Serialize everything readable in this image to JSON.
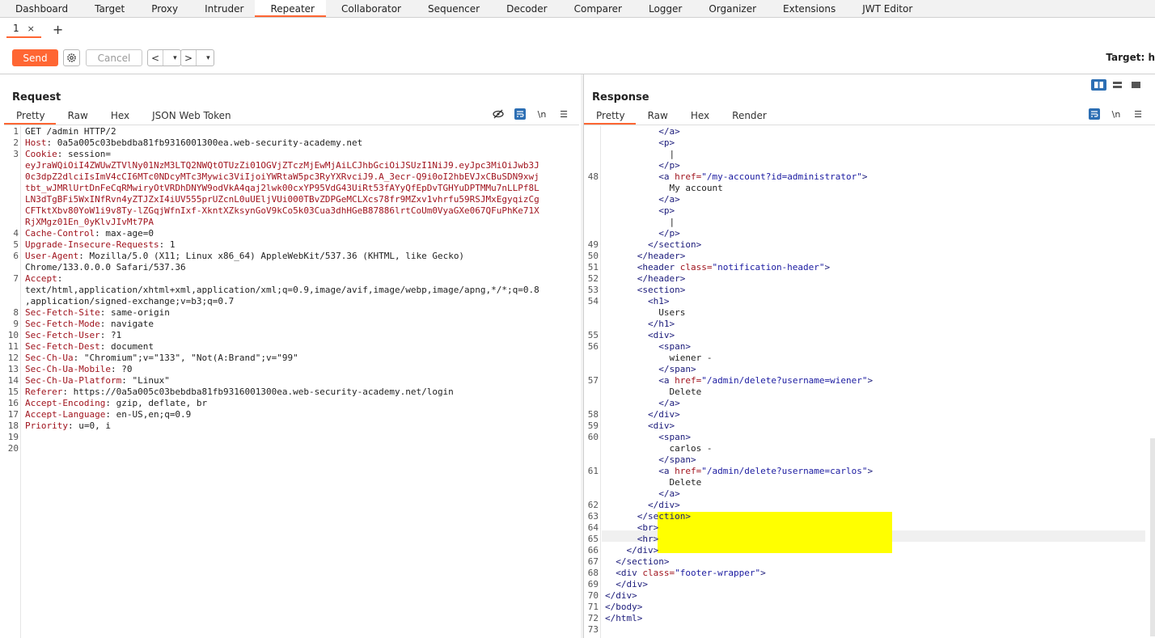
{
  "topnav": [
    "Dashboard",
    "Target",
    "Proxy",
    "Intruder",
    "Repeater",
    "Collaborator",
    "Sequencer",
    "Decoder",
    "Comparer",
    "Logger",
    "Organizer",
    "Extensions",
    "JWT Editor"
  ],
  "active_tab": "Repeater",
  "subtab": {
    "label": "1",
    "close": "×",
    "add": "+"
  },
  "toolbar": {
    "send": "Send",
    "cancel": "Cancel",
    "back": "<",
    "forward": ">",
    "dropdown": "▾",
    "target": "Target: h"
  },
  "request": {
    "title": "Request",
    "tabs": [
      "Pretty",
      "Raw",
      "Hex",
      "JSON Web Token"
    ],
    "icons": {
      "hide": "eye-slash-icon",
      "wrap": "wrap-icon",
      "newline": "\\n",
      "menu": "☰"
    },
    "lines": [
      {
        "n": "1",
        "name": "",
        "value": "GET /admin HTTP/2"
      },
      {
        "n": "2",
        "name": "Host",
        "value": ": 0a5a005c03bebdba81fb9316001300ea.web-security-academy.net"
      },
      {
        "n": "3",
        "name": "Cookie",
        "value": ": session="
      },
      {
        "n": "",
        "name": "eyJraWQiOiI4ZWUwZTVlNy01NzM3LTQ2NWQtOTUzZi01OGVjZTczMjEwMjAiLCJhbGciOiJSUzI1NiJ9.eyJpc3MiOiJwb3J",
        "value": ""
      },
      {
        "n": "",
        "name": "0c3dpZ2dlciIsImV4cCI6MTc0NDcyMTc3Mywic3ViIjoiYWRtaW5pc3RyYXRvciJ9.A_3ecr-Q9i0oI2hbEVJxCBuSDN9xwj",
        "value": ""
      },
      {
        "n": "",
        "name": "tbt_wJMRlUrtDnFeCqRMwiryOtVRDhDNYW9odVkA4qaj2lwk00cxYP95VdG43UiRt53fAYyQfEpDvTGHYuDPTMMu7nLLPf8L",
        "value": ""
      },
      {
        "n": "",
        "name": "LN3dTgBFi5WxINfRvn4yZTJZxI4iUV555prUZcnL0uUEljVUi000TBvZDPGeMCLXcs78fr9MZxv1vhrfu59RSJMxEgyqizCg",
        "value": ""
      },
      {
        "n": "",
        "name": "CFTktXbv80YoW1i9v8Ty-lZGqjWfnIxf-XkntXZksynGoV9kCo5k03Cua3dhHGeB87886lrtCoUm0VyaGXe067QFuPhKe71X",
        "value": ""
      },
      {
        "n": "",
        "name": "RjXMgz01En_0yKlvJIvMt7PA",
        "value": ""
      },
      {
        "n": "4",
        "name": "Cache-Control",
        "value": ": max-age=0"
      },
      {
        "n": "5",
        "name": "Upgrade-Insecure-Requests",
        "value": ": 1"
      },
      {
        "n": "6",
        "name": "User-Agent",
        "value": ": Mozilla/5.0 (X11; Linux x86_64) AppleWebKit/537.36 (KHTML, like Gecko)"
      },
      {
        "n": "",
        "name": "",
        "value": "Chrome/133.0.0.0 Safari/537.36"
      },
      {
        "n": "7",
        "name": "Accept",
        "value": ":"
      },
      {
        "n": "",
        "name": "",
        "value": "text/html,application/xhtml+xml,application/xml;q=0.9,image/avif,image/webp,image/apng,*/*;q=0.8"
      },
      {
        "n": "",
        "name": "",
        "value": ",application/signed-exchange;v=b3;q=0.7"
      },
      {
        "n": "8",
        "name": "Sec-Fetch-Site",
        "value": ": same-origin"
      },
      {
        "n": "9",
        "name": "Sec-Fetch-Mode",
        "value": ": navigate"
      },
      {
        "n": "10",
        "name": "Sec-Fetch-User",
        "value": ": ?1"
      },
      {
        "n": "11",
        "name": "Sec-Fetch-Dest",
        "value": ": document"
      },
      {
        "n": "12",
        "name": "Sec-Ch-Ua",
        "value": ": \"Chromium\";v=\"133\", \"Not(A:Brand\";v=\"99\""
      },
      {
        "n": "13",
        "name": "Sec-Ch-Ua-Mobile",
        "value": ": ?0"
      },
      {
        "n": "14",
        "name": "Sec-Ch-Ua-Platform",
        "value": ": \"Linux\""
      },
      {
        "n": "15",
        "name": "Referer",
        "value": ": https://0a5a005c03bebdba81fb9316001300ea.web-security-academy.net/login"
      },
      {
        "n": "16",
        "name": "Accept-Encoding",
        "value": ": gzip, deflate, br"
      },
      {
        "n": "17",
        "name": "Accept-Language",
        "value": ": en-US,en;q=0.9"
      },
      {
        "n": "18",
        "name": "Priority",
        "value": ": u=0, i"
      },
      {
        "n": "19",
        "name": "",
        "value": ""
      },
      {
        "n": "20",
        "name": "",
        "value": ""
      }
    ]
  },
  "response": {
    "title": "Response",
    "tabs": [
      "Pretty",
      "Raw",
      "Hex",
      "Render"
    ],
    "icons": {
      "wrap": "wrap-icon",
      "newline": "\\n",
      "menu": "☰"
    },
    "lines": [
      {
        "n": "",
        "t": "          </a>"
      },
      {
        "n": "",
        "t": "          <p>"
      },
      {
        "n": "",
        "t": "            |"
      },
      {
        "n": "",
        "t": "          </p>"
      },
      {
        "n": "48",
        "t": "          <a href=\"/my-account?id=administrator\">"
      },
      {
        "n": "",
        "t": "            My account"
      },
      {
        "n": "",
        "t": "          </a>"
      },
      {
        "n": "",
        "t": "          <p>"
      },
      {
        "n": "",
        "t": "            |"
      },
      {
        "n": "",
        "t": "          </p>"
      },
      {
        "n": "49",
        "t": "        </section>"
      },
      {
        "n": "50",
        "t": "      </header>"
      },
      {
        "n": "51",
        "t": "      <header class=\"notification-header\">"
      },
      {
        "n": "52",
        "t": "      </header>"
      },
      {
        "n": "53",
        "t": "      <section>"
      },
      {
        "n": "54",
        "t": "        <h1>"
      },
      {
        "n": "",
        "t": "          Users"
      },
      {
        "n": "",
        "t": "        </h1>"
      },
      {
        "n": "55",
        "t": "        <div>"
      },
      {
        "n": "56",
        "t": "          <span>"
      },
      {
        "n": "",
        "t": "            wiener -"
      },
      {
        "n": "",
        "t": "          </span>"
      },
      {
        "n": "57",
        "t": "          <a href=\"/admin/delete?username=wiener\">"
      },
      {
        "n": "",
        "t": "            Delete"
      },
      {
        "n": "",
        "t": "          </a>"
      },
      {
        "n": "58",
        "t": "        </div>"
      },
      {
        "n": "59",
        "t": "        <div>"
      },
      {
        "n": "60",
        "t": "          <span>"
      },
      {
        "n": "",
        "t": "            carlos -"
      },
      {
        "n": "",
        "t": "          </span>"
      },
      {
        "n": "61",
        "t": "          <a href=\"/admin/delete?username=carlos\">"
      },
      {
        "n": "",
        "t": "            Delete"
      },
      {
        "n": "",
        "t": "          </a>"
      },
      {
        "n": "62",
        "t": "        </div>"
      },
      {
        "n": "63",
        "t": "      </section>"
      },
      {
        "n": "64",
        "t": "      <br>"
      },
      {
        "n": "65",
        "t": "      <hr>"
      },
      {
        "n": "66",
        "t": "    </div>"
      },
      {
        "n": "67",
        "t": "  </section>"
      },
      {
        "n": "68",
        "t": "  <div class=\"footer-wrapper\">"
      },
      {
        "n": "69",
        "t": "  </div>"
      },
      {
        "n": "70",
        "t": "</div>"
      },
      {
        "n": "71",
        "t": "</body>"
      },
      {
        "n": "72",
        "t": "</html>"
      },
      {
        "n": "73",
        "t": ""
      }
    ]
  },
  "colors": {
    "accent": "#ff6633",
    "header_name": "#a0141e",
    "highlight": "#ffff00",
    "icon_blue": "#2d6fb4"
  }
}
